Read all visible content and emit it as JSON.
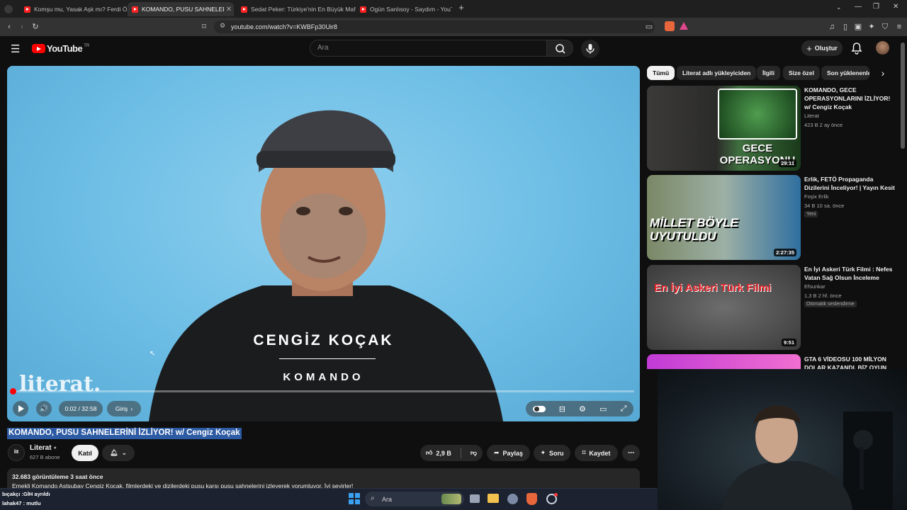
{
  "browser": {
    "tabs": [
      {
        "title": "Komşu mu, Yasak Aşk mı? Ferdi Özdemir",
        "active": false
      },
      {
        "title": "KOMANDO, PUSU SAHNELERİNİ İZLİYOR",
        "active": true
      },
      {
        "title": "Sedat Peker: Türkiye'nin En Büyük Mafya",
        "active": false
      },
      {
        "title": "Ogün Sanlısoy - Saydım - YouTube",
        "active": false
      }
    ],
    "new_tab": "+",
    "url": "youtube.com/watch?v=KWBFp30Uir8"
  },
  "youtube": {
    "logo_text": "YouTube",
    "logo_region": "TR",
    "search_placeholder": "Ara",
    "create_label": "Oluştur"
  },
  "player": {
    "name_overlay": "CENGİZ KOÇAK",
    "role_overlay": "KOMANDO",
    "watermark": "literat.",
    "time": "0:02 / 32:58",
    "chapter": "Giriş",
    "progress": 0.001
  },
  "video": {
    "title": "KOMANDO, PUSU SAHNELERİNİ İZLİYOR! w/ Cengiz Koçak",
    "channel": "Literat",
    "subscribers": "627 B abone",
    "join_label": "Katıl",
    "likes": "2,9 B",
    "share_label": "Paylaş",
    "ask_label": "Soru",
    "save_label": "Kaydet",
    "views_time": "32.683 görüntüleme  3 saat önce",
    "description": "Emekli Komando Astsubay Cengiz Koçak, filmlerdeki ve dizilerdeki pusu karşı pusu sahnelerini izleyerek yorumluyor. İyi seyirler!"
  },
  "chips": [
    "Tümü",
    "Literat adlı yükleyiciden",
    "İlgili",
    "Size özel",
    "Son yüklenenler"
  ],
  "recommendations": [
    {
      "title": "KOMANDO, GECE OPERASYONLARINI İZLİYOR! w/ Cengiz Koçak",
      "channel": "Literat",
      "meta": "423 B  2 ay önce",
      "duration": "29:11",
      "thumb_text": "GECE OPERASYONU",
      "tag": ""
    },
    {
      "title": "Erlik, FETÖ Propaganda Dizilerini İnceliyor! | Yayın Kesit",
      "channel": "Foşix Erlik",
      "meta": "34 B  10 sa. önce",
      "duration": "2:27:35",
      "thumb_text": "MİLLET BÖYLE UYUTULDU",
      "tag": "Yeni"
    },
    {
      "title": "En İyi Askeri Türk Filmi : Nefes Vatan Sağ Olsun İnceleme",
      "channel": "Efsunkar",
      "meta": "1,3 B  2 hf. önce",
      "duration": "9:51",
      "thumb_text": "En İyi Askeri Türk Filmi",
      "tag": "Otomatik seslendirme"
    },
    {
      "title": "GTA 6 VİDEOSU 100 MİLYON DOLAR KAZANDI, BİZ OYUN",
      "channel": "",
      "meta": "",
      "duration": "",
      "thumb_text": "",
      "tag": ""
    }
  ],
  "taskbar": {
    "search_placeholder": "Ara",
    "chat_lines": [
      "bıçakçı :GİH ayrıldı",
      "lahak47 : mutlu"
    ]
  },
  "colors": {
    "accent_red": "#ff0000",
    "bg": "#0f0f0f",
    "title_highlight": "#2c5aa3",
    "player_bg": "#65b5de"
  }
}
